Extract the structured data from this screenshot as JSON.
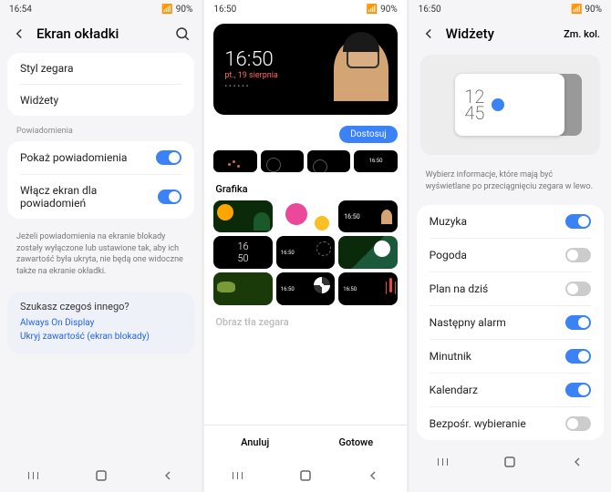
{
  "p1": {
    "status": {
      "time": "16:54",
      "battery": "90%"
    },
    "title": "Ekran okładki",
    "items": {
      "clockstyle": "Styl zegara",
      "widgets": "Widżety"
    },
    "notif_label": "Powiadomienia",
    "show_notif": "Pokaż powiadomienia",
    "screen_on": "Włącz ekran dla powiadomień",
    "desc": "Jeżeli powiadomienia na ekranie blokady zostały wyłączone lub ustawione tak, aby ich zawartość była ukryta, nie będą one widoczne także na ekranie okładki.",
    "search_title": "Szukasz czegoś innego?",
    "link1": "Always On Display",
    "link2": "Ukryj zawartość (ekran blokady)"
  },
  "p2": {
    "status": {
      "time": "16:50",
      "battery": "90%"
    },
    "preview": {
      "time": "16:50",
      "date": "pt., 19 sierpnia"
    },
    "customize": "Dostosuj",
    "graphics_label": "Grafika",
    "bg_label": "Obraz tła zegara",
    "thumbs": {
      "t4": "16:50",
      "gc": "16:50",
      "gd": "16\n50",
      "ge": "16:50",
      "gh": "16:50",
      "gi": "16:50"
    },
    "cancel": "Anuluj",
    "done": "Gotowe"
  },
  "p3": {
    "status": {
      "time": "16:50",
      "battery": "90%"
    },
    "title": "Widżety",
    "reorder": "Zm. kol.",
    "preview_time": "12\n45",
    "desc": "Wybierz informacje, które mają być wyświetlane po przeciągnięciu zegara w lewo.",
    "toggles": [
      {
        "label": "Muzyka",
        "on": true
      },
      {
        "label": "Pogoda",
        "on": false
      },
      {
        "label": "Plan na dziś",
        "on": false
      },
      {
        "label": "Następny alarm",
        "on": true
      },
      {
        "label": "Minutnik",
        "on": true
      },
      {
        "label": "Kalendarz",
        "on": true
      },
      {
        "label": "Bezpośr. wybieranie",
        "on": false
      }
    ]
  }
}
